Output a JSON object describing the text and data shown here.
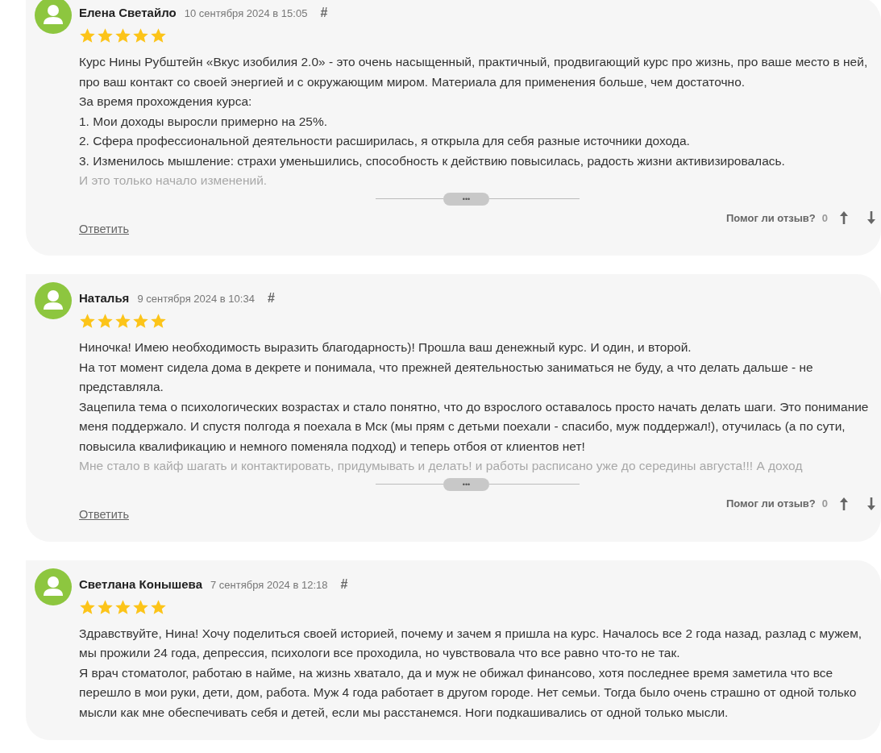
{
  "reviews": [
    {
      "author": "Елена Светайло",
      "date": "10 сентября 2024 в 15:05",
      "anchor": "#",
      "stars": 5,
      "paragraphs": [
        "Курс Нины Рубштейн «Вкус изобилия 2.0» - это очень насыщенный, практичный, продвигающий курс про жизнь, про ваше место в ней, про ваш контакт со своей энергией и с окружающим миром. Материала для применения больше, чем достаточно.",
        "За время прохождения курса:",
        "1. Мои доходы выросли примерно на 25%.",
        "2. Сфера профессиональной деятельности расширилась, я открыла для себя разные источники дохода.",
        "3. Изменилось мышление: страхи уменьшились, способность к действию повысилась, радость жизни активизировалась."
      ],
      "faded": "И это только начало изменений.",
      "expand": "•••",
      "reply": "Ответить",
      "helpful_label": "Помог ли отзыв?",
      "helpful_count": "0"
    },
    {
      "author": "Наталья",
      "date": "9 сентября 2024 в 10:34",
      "anchor": "#",
      "stars": 5,
      "paragraphs": [
        "Ниночка! Имею необходимость выразить благодарность)! Прошла ваш денежный курс. И один, и второй.",
        "На тот момент сидела дома в декрете и понимала, что прежней деятельностью заниматься не буду, а что делать дальше - не представляла.",
        "Зацепила тема о психологических возрастах и стало понятно, что до взрослого оставалось просто начать делать шаги. Это понимание меня поддержало. И спустя полгода я поехала в Мск (мы прям с детьми поехали - спасибо, муж поддержал!), отучилась (а по сути, повысила квалификацию и немного поменяла подход) и теперь отбоя от клиентов нет!"
      ],
      "faded": "Мне стало в кайф шагать и контактировать, придумывать и делать! и работы расписано уже до середины августа!!! А доход",
      "expand": "•••",
      "reply": "Ответить",
      "helpful_label": "Помог ли отзыв?",
      "helpful_count": "0"
    },
    {
      "author": "Светлана Конышева",
      "date": "7 сентября 2024 в 12:18",
      "anchor": "#",
      "stars": 5,
      "paragraphs": [
        "Здравствуйте, Нина! Хочу поделиться своей историей, почему и зачем я пришла на курс. Началось все 2 года назад, разлад с мужем, мы прожили 24 года, депрессия, психологи все проходила, но чувствовала что все равно что-то не так.",
        "Я врач стоматолог, работаю в найме, на жизнь хватало, да и муж не обижал финансово, хотя последнее время заметила что все перешло в мои руки, дети, дом, работа. Муж 4 года работает в другом городе. Нет семьи. Тогда было очень страшно от одной только мысли как мне обеспечивать себя и детей, если мы расстанемся. Ноги подкашивались от одной только мысли."
      ]
    }
  ]
}
